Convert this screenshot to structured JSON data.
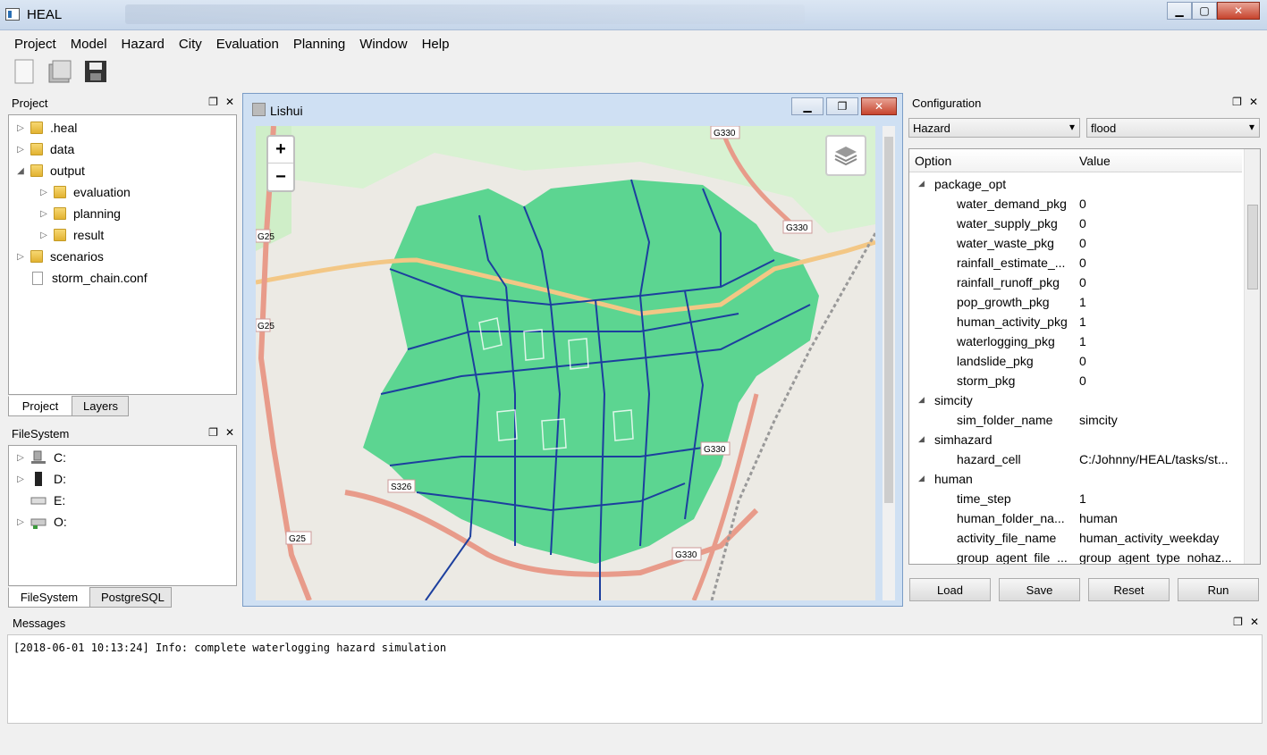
{
  "window": {
    "title": "HEAL"
  },
  "menu": [
    "Project",
    "Model",
    "Hazard",
    "City",
    "Evaluation",
    "Planning",
    "Window",
    "Help"
  ],
  "toolbar": {
    "icons": [
      "new-file-icon",
      "open-folder-icon",
      "save-icon"
    ]
  },
  "project_panel": {
    "title": "Project",
    "tree": [
      {
        "label": ".heal",
        "type": "folder",
        "expandable": true,
        "level": 0
      },
      {
        "label": "data",
        "type": "folder",
        "expandable": true,
        "level": 0
      },
      {
        "label": "output",
        "type": "folder",
        "expanded": true,
        "level": 0
      },
      {
        "label": "evaluation",
        "type": "folder",
        "expandable": true,
        "level": 1
      },
      {
        "label": "planning",
        "type": "folder",
        "expandable": true,
        "level": 1
      },
      {
        "label": "result",
        "type": "folder",
        "expandable": true,
        "level": 1
      },
      {
        "label": "scenarios",
        "type": "folder",
        "expandable": true,
        "level": 0
      },
      {
        "label": "storm_chain.conf",
        "type": "file",
        "level": 0
      }
    ],
    "tabs": [
      "Project",
      "Layers"
    ]
  },
  "filesystem_panel": {
    "title": "FileSystem",
    "drives": [
      "C:",
      "D:",
      "E:",
      "O:"
    ],
    "tabs": [
      "FileSystem",
      "PostgreSQL"
    ]
  },
  "map_window": {
    "title": "Lishui",
    "zoom_in": "+",
    "zoom_out": "−",
    "road_labels": [
      "G330",
      "G330",
      "G25",
      "G25",
      "G25",
      "S326",
      "G330",
      "G330"
    ],
    "colors": {
      "flood": "#4fd38a",
      "roads": "#1c3f9e",
      "highway": "#e89b8a"
    }
  },
  "configuration": {
    "title": "Configuration",
    "combo1": "Hazard",
    "combo2": "flood",
    "col_option": "Option",
    "col_value": "Value",
    "rows": [
      {
        "key": "package_opt",
        "value": "",
        "group": true
      },
      {
        "key": "water_demand_pkg",
        "value": "0"
      },
      {
        "key": "water_supply_pkg",
        "value": "0"
      },
      {
        "key": "water_waste_pkg",
        "value": "0"
      },
      {
        "key": "rainfall_estimate_...",
        "value": "0"
      },
      {
        "key": "rainfall_runoff_pkg",
        "value": "0"
      },
      {
        "key": "pop_growth_pkg",
        "value": "1"
      },
      {
        "key": "human_activity_pkg",
        "value": "1"
      },
      {
        "key": "waterlogging_pkg",
        "value": "1"
      },
      {
        "key": "landslide_pkg",
        "value": "0"
      },
      {
        "key": "storm_pkg",
        "value": "0"
      },
      {
        "key": "simcity",
        "value": "",
        "group": true
      },
      {
        "key": "sim_folder_name",
        "value": "simcity"
      },
      {
        "key": "simhazard",
        "value": "",
        "group": true
      },
      {
        "key": "hazard_cell",
        "value": "C:/Johnny/HEAL/tasks/st..."
      },
      {
        "key": "human",
        "value": "",
        "group": true
      },
      {
        "key": "time_step",
        "value": "1"
      },
      {
        "key": "human_folder_na...",
        "value": "human"
      },
      {
        "key": "activity_file_name",
        "value": "human_activity_weekday"
      },
      {
        "key": "group_agent_file_...",
        "value": "group_agent_type_nohaz..."
      }
    ],
    "buttons": {
      "load": "Load",
      "save": "Save",
      "reset": "Reset",
      "run": "Run"
    }
  },
  "messages": {
    "title": "Messages",
    "log": "[2018-06-01 10:13:24] Info: complete waterlogging hazard simulation"
  }
}
